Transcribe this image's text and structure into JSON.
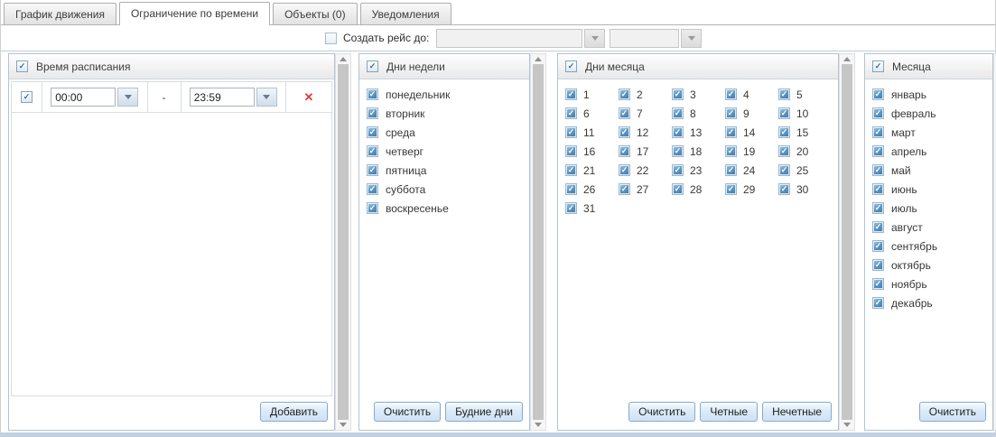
{
  "tabs": [
    {
      "label": "График движения"
    },
    {
      "label": "Ограничение по времени"
    },
    {
      "label": "Объекты (0)"
    },
    {
      "label": "Уведомления"
    }
  ],
  "create_trip": {
    "label": "Создать рейс до:",
    "date_value": "",
    "time_value": ""
  },
  "schedule_panel": {
    "title": "Время расписания",
    "row": {
      "start_time": "00:00",
      "separator": "-",
      "end_time": "23:59",
      "delete_glyph": "✕"
    },
    "add_button": "Добавить"
  },
  "weekdays_panel": {
    "title": "Дни недели",
    "items": [
      "понедельник",
      "вторник",
      "среда",
      "четверг",
      "пятница",
      "суббота",
      "воскресенье"
    ],
    "clear_button": "Очистить",
    "weekdays_button": "Будние дни"
  },
  "monthdays_panel": {
    "title": "Дни месяца",
    "items": [
      "1",
      "2",
      "3",
      "4",
      "5",
      "6",
      "7",
      "8",
      "9",
      "10",
      "11",
      "12",
      "13",
      "14",
      "15",
      "16",
      "17",
      "18",
      "19",
      "20",
      "21",
      "22",
      "23",
      "24",
      "25",
      "26",
      "27",
      "28",
      "29",
      "30",
      "31"
    ],
    "clear_button": "Очистить",
    "even_button": "Четные",
    "odd_button": "Нечетные"
  },
  "months_panel": {
    "title": "Месяца",
    "items": [
      "январь",
      "февраль",
      "март",
      "апрель",
      "май",
      "июнь",
      "июль",
      "август",
      "сентябрь",
      "октябрь",
      "ноябрь",
      "декабрь"
    ],
    "clear_button": "Очистить"
  }
}
